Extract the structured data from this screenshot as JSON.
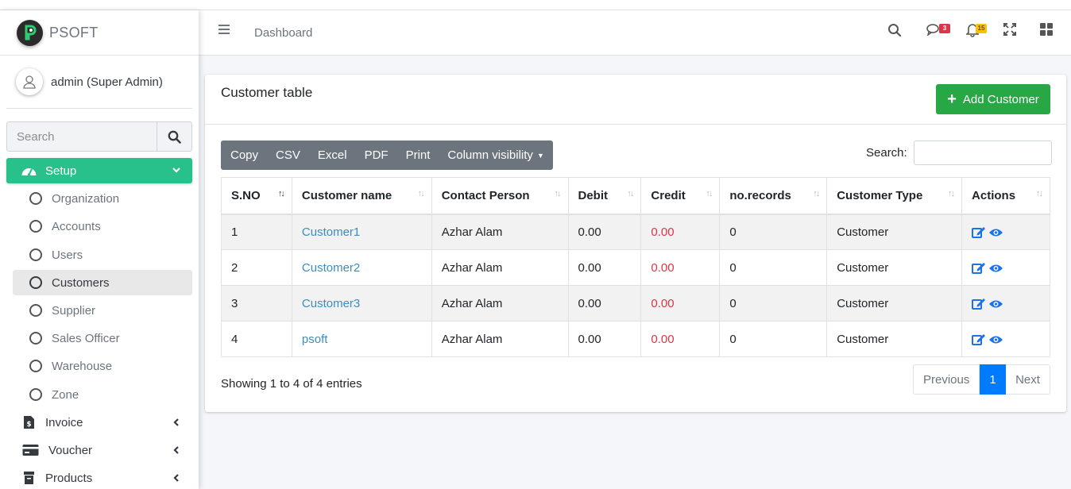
{
  "brand": {
    "name": "PSOFT"
  },
  "user": {
    "name": "admin  (Super Admin)"
  },
  "sidebar": {
    "search_placeholder": "Search",
    "setup_label": "Setup",
    "sub_items": [
      {
        "label": "Organization"
      },
      {
        "label": "Accounts"
      },
      {
        "label": "Users"
      },
      {
        "label": "Customers"
      },
      {
        "label": "Supplier"
      },
      {
        "label": "Sales Officer"
      },
      {
        "label": "Warehouse"
      },
      {
        "label": "Zone"
      }
    ],
    "items": [
      {
        "label": "Invoice"
      },
      {
        "label": "Voucher"
      },
      {
        "label": "Products"
      }
    ]
  },
  "header": {
    "breadcrumb": "Dashboard",
    "messages_count": "3",
    "notifications_count": "15"
  },
  "card": {
    "title": "Customer table",
    "add_button": "Add Customer"
  },
  "toolbar": {
    "buttons": [
      "Copy",
      "CSV",
      "Excel",
      "PDF",
      "Print",
      "Column visibility"
    ],
    "search_label": "Search:"
  },
  "table": {
    "columns": [
      "S.NO",
      "Customer name",
      "Contact Person",
      "Debit",
      "Credit",
      "no.records",
      "Customer Type",
      "Actions"
    ],
    "rows": [
      {
        "sno": "1",
        "name": "Customer1",
        "contact": "Azhar Alam",
        "debit": "0.00",
        "credit": "0.00",
        "records": "0",
        "type": "Customer"
      },
      {
        "sno": "2",
        "name": "Customer2",
        "contact": "Azhar Alam",
        "debit": "0.00",
        "credit": "0.00",
        "records": "0",
        "type": "Customer"
      },
      {
        "sno": "3",
        "name": "Customer3",
        "contact": "Azhar Alam",
        "debit": "0.00",
        "credit": "0.00",
        "records": "0",
        "type": "Customer"
      },
      {
        "sno": "4",
        "name": "psoft",
        "contact": "Azhar Alam",
        "debit": "0.00",
        "credit": "0.00",
        "records": "0",
        "type": "Customer"
      }
    ]
  },
  "footer": {
    "info": "Showing 1 to 4 of 4 entries",
    "previous": "Previous",
    "current_page": "1",
    "next": "Next"
  },
  "colors": {
    "setup_active": "#28c18c",
    "add_button": "#28a745",
    "link": "#3c8dbc",
    "credit": "#dc3545",
    "pager_active": "#007bff",
    "toolbar": "#6c757d"
  }
}
